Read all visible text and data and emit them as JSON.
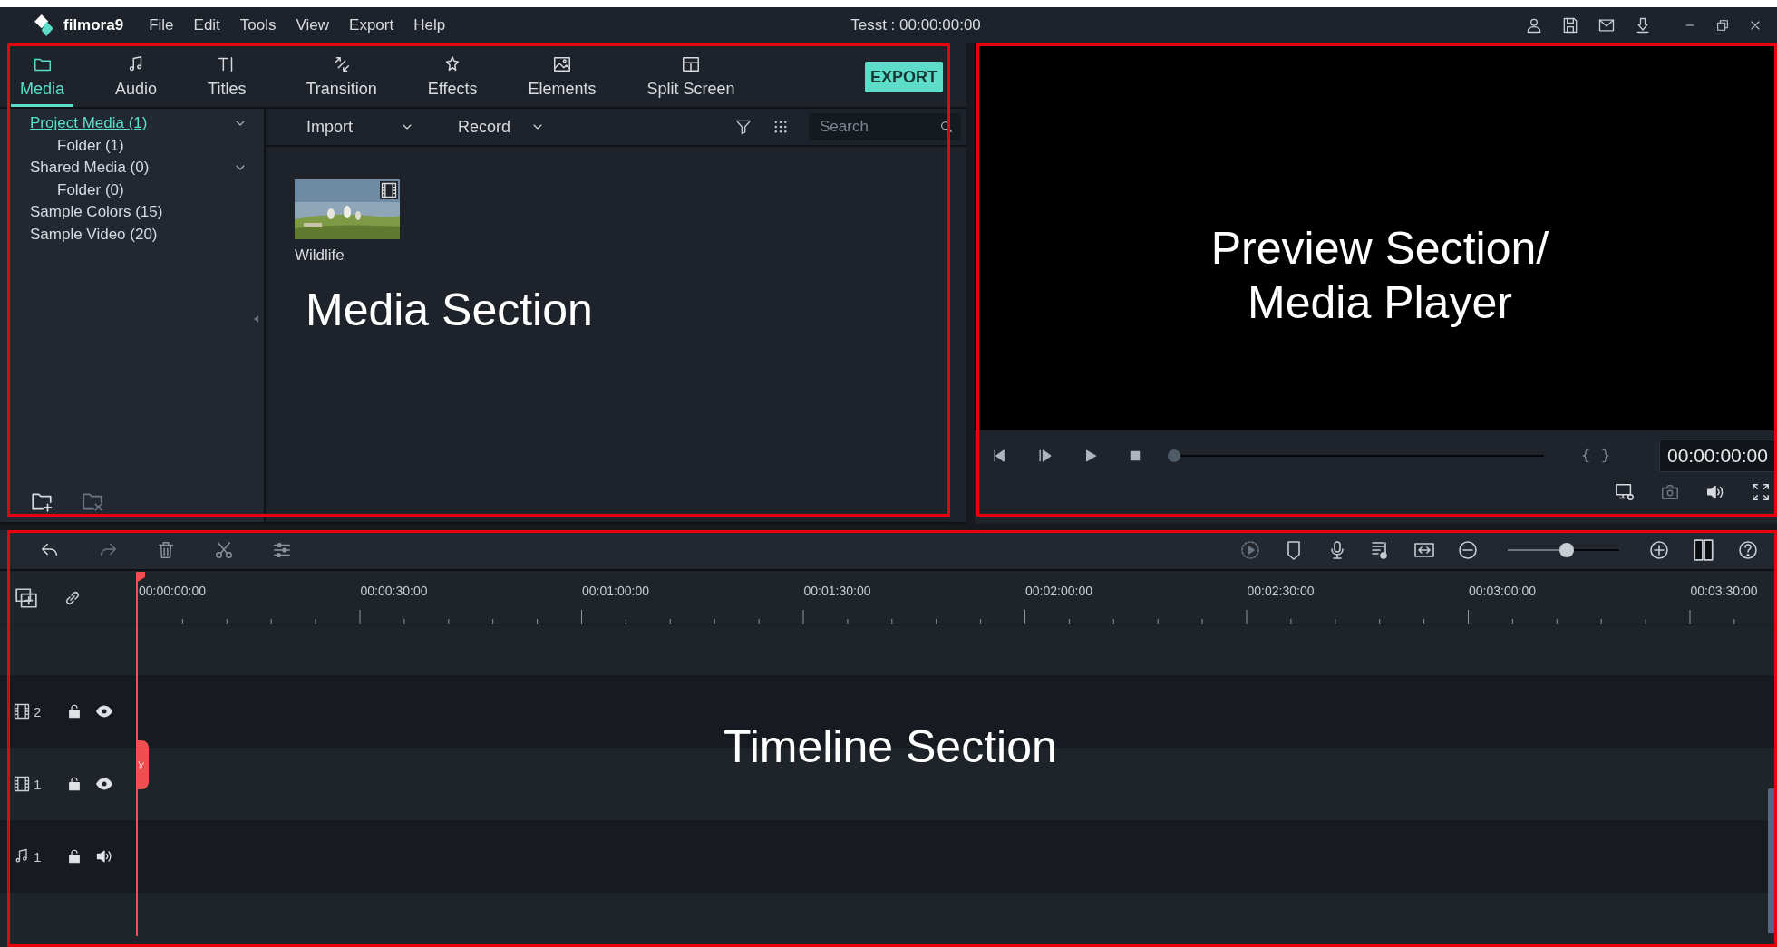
{
  "window": {
    "logo": "filmora9",
    "menu": [
      "File",
      "Edit",
      "Tools",
      "View",
      "Export",
      "Help"
    ],
    "title": "Tesst : 00:00:00:00"
  },
  "media": {
    "tabs": [
      {
        "label": "Media",
        "selected": true
      },
      {
        "label": "Audio",
        "selected": false
      },
      {
        "label": "Titles",
        "selected": false
      },
      {
        "label": "Transition",
        "selected": false
      },
      {
        "label": "Effects",
        "selected": false
      },
      {
        "label": "Elements",
        "selected": false
      },
      {
        "label": "Split Screen",
        "selected": false
      }
    ],
    "export_button": "EXPORT",
    "library": [
      {
        "label": "Project Media (1)",
        "selected": true,
        "children": [
          {
            "label": "Folder (1)",
            "selected": false
          }
        ]
      },
      {
        "label": "Shared Media (0)",
        "selected": false,
        "children": [
          {
            "label": "Folder (0)",
            "selected": false
          }
        ]
      },
      {
        "label": "Sample Colors (15)",
        "selected": false
      },
      {
        "label": "Sample Video (20)",
        "selected": false
      }
    ],
    "import_button": "Import",
    "record_button": "Record",
    "search": {
      "placeholder": "Search"
    },
    "items": [
      {
        "name": "Wildlife",
        "kind": "video"
      }
    ],
    "annotation": {
      "text": "Media Section",
      "boxed": true
    }
  },
  "preview": {
    "timecode": "00:00:00:00",
    "progress": {
      "level": 0
    },
    "annotation": {
      "lines": [
        "Preview Section/",
        "Media Player"
      ],
      "boxed": true
    }
  },
  "timeline": {
    "zoom": {
      "level": 0.53
    },
    "ruler": [
      "00:00:00:00",
      "00:00:30:00",
      "00:01:00:00",
      "00:01:30:00",
      "00:02:00:00",
      "00:02:30:00",
      "00:03:00:00",
      "00:03:30:00"
    ],
    "tracks": [
      {
        "kind": "video",
        "number": "2"
      },
      {
        "kind": "video",
        "number": "1"
      },
      {
        "kind": "audio",
        "number": "1"
      }
    ],
    "annotation": {
      "text": "Timeline Section",
      "boxed": true
    }
  }
}
